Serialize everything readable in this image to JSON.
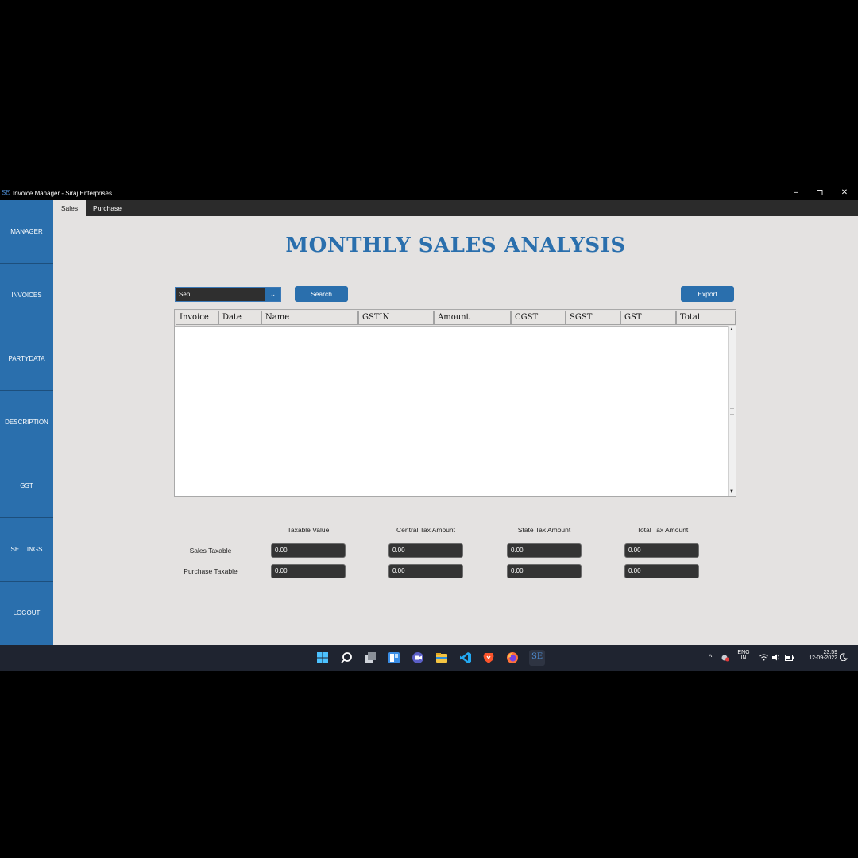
{
  "window": {
    "title": "Invoice Manager - Siraj Enterprises",
    "logo": "SE"
  },
  "sidebar": {
    "items": [
      {
        "label": "MANAGER"
      },
      {
        "label": "INVOICES"
      },
      {
        "label": "PARTYDATA"
      },
      {
        "label": "DESCRIPTION"
      },
      {
        "label": "GST"
      },
      {
        "label": "SETTINGS"
      },
      {
        "label": "LOGOUT"
      }
    ]
  },
  "tabs": [
    {
      "label": "Sales",
      "active": true
    },
    {
      "label": "Purchase",
      "active": false
    }
  ],
  "page": {
    "title": "MONTHLY SALES ANALYSIS"
  },
  "filter": {
    "month": "Sep",
    "search_label": "Search",
    "export_label": "Export"
  },
  "table": {
    "columns": [
      "Invoice",
      "Date",
      "Name",
      "GSTIN",
      "Amount",
      "CGST",
      "SGST",
      "GST",
      "Total"
    ],
    "rows": []
  },
  "summary": {
    "columns": [
      "Taxable Value",
      "Central Tax Amount",
      "State Tax Amount",
      "Total Tax Amount"
    ],
    "rows": [
      {
        "label": "Sales Taxable",
        "values": [
          "0.00",
          "0.00",
          "0.00",
          "0.00"
        ]
      },
      {
        "label": "Purchase Taxable",
        "values": [
          "0.00",
          "0.00",
          "0.00",
          "0.00"
        ]
      }
    ]
  },
  "taskbar": {
    "tray": {
      "lang1": "ENG",
      "lang2": "IN",
      "time": "23:59",
      "date": "12-09-2022"
    },
    "apps": [
      "windows-start-icon",
      "search-icon",
      "task-view-icon",
      "widgets-icon",
      "chat-icon",
      "file-explorer-icon",
      "vscode-icon",
      "brave-icon",
      "firefox-icon",
      "invoice-manager-icon"
    ]
  },
  "colors": {
    "accent": "#2a6fad",
    "background": "#e4e2e1",
    "field": "#343434",
    "taskbar": "#1f2430"
  }
}
